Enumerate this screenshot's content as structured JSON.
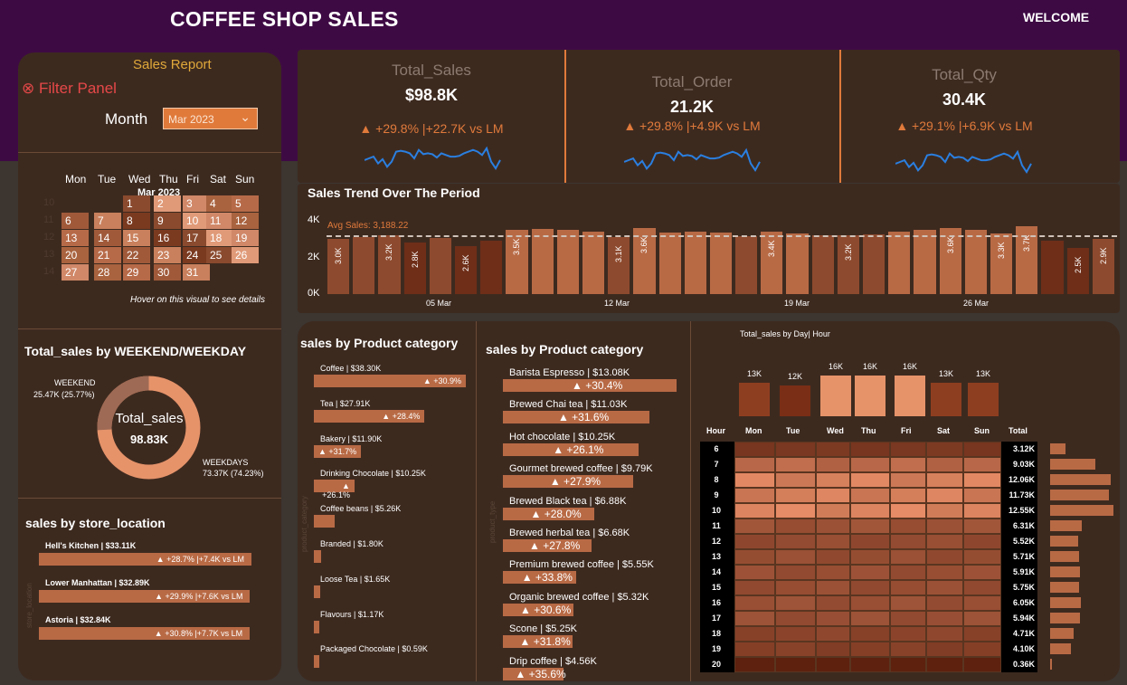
{
  "app": {
    "title": "COFFEE SHOP SALES",
    "welcome": "WELCOME"
  },
  "filter": {
    "report_label": "Sales Report",
    "panel_label": "Filter Panel",
    "month_label": "Month",
    "month_value": "Mar 2023",
    "calendar": {
      "month_title": "Mar 2023",
      "weekdays": [
        "Mon",
        "Tue",
        "Wed",
        "Thu",
        "Fri",
        "Sat",
        "Sun"
      ],
      "weeks": [
        "10",
        "11",
        "12",
        "13",
        "14"
      ],
      "days": [
        {
          "d": "1"
        },
        {
          "d": "2"
        },
        {
          "d": "3"
        },
        {
          "d": "4"
        },
        {
          "d": "5"
        },
        {
          "d": "6"
        },
        {
          "d": "7"
        },
        {
          "d": "8"
        },
        {
          "d": "9"
        },
        {
          "d": "10"
        },
        {
          "d": "11"
        },
        {
          "d": "12"
        },
        {
          "d": "13"
        },
        {
          "d": "14"
        },
        {
          "d": "15"
        },
        {
          "d": "16"
        },
        {
          "d": "17"
        },
        {
          "d": "18"
        },
        {
          "d": "19"
        },
        {
          "d": "20"
        },
        {
          "d": "21"
        },
        {
          "d": "22"
        },
        {
          "d": "23"
        },
        {
          "d": "24"
        },
        {
          "d": "25"
        },
        {
          "d": "26"
        },
        {
          "d": "27"
        },
        {
          "d": "28"
        },
        {
          "d": "29"
        },
        {
          "d": "30"
        },
        {
          "d": "31"
        }
      ],
      "hover_hint": "Hover on this visual to see details"
    }
  },
  "weekend": {
    "title": "Total_sales by WEEKEND/WEEKDAY",
    "center_label": "Total_sales",
    "center_value": "98.83K",
    "weekend_label": "WEEKEND",
    "weekend_value": "25.47K (25.77%)",
    "weekday_label": "WEEKDAYS",
    "weekday_value": "73.37K (74.23%)",
    "weekend_share": 0.2577
  },
  "store": {
    "title": "sales by store_location",
    "axis_label": "store_location",
    "items": [
      {
        "name": "Hell's Kitchen | $33.11K",
        "change": "▲ +28.7% |+7.4K vs LM",
        "value": 33.11
      },
      {
        "name": "Lower Manhattan | $32.89K",
        "change": "▲ +29.9% |+7.6K vs LM",
        "value": 32.89
      },
      {
        "name": "Astoria | $32.84K",
        "change": "▲ +30.8% |+7.7K vs LM",
        "value": 32.84
      }
    ]
  },
  "kpis": [
    {
      "label": "Total_Sales",
      "value": "$98.8K",
      "change": "▲ +29.8% |+22.7K vs LM"
    },
    {
      "label": "Total_Order",
      "value": "21.2K",
      "change": "▲ +29.8% |+4.9K vs LM"
    },
    {
      "label": "Total_Qty",
      "value": "30.4K",
      "change": "▲ +29.1% |+6.9K vs LM"
    }
  ],
  "trend_title": "Sales Trend Over The Period",
  "trend_avg_label": "Avg Sales: 3,188.22",
  "trend_y_ticks": [
    "4K",
    "2K",
    "0K"
  ],
  "trend_x_ticks": [
    "05 Mar",
    "12 Mar",
    "19 Mar",
    "26 Mar"
  ],
  "chart_data": {
    "type": "bar",
    "title": "Sales Trend Over The Period",
    "x": [
      "Mar 1",
      "Mar 2",
      "Mar 3",
      "Mar 4",
      "Mar 5",
      "Mar 6",
      "Mar 7",
      "Mar 8",
      "Mar 9",
      "Mar 10",
      "Mar 11",
      "Mar 12",
      "Mar 13",
      "Mar 14",
      "Mar 15",
      "Mar 16",
      "Mar 17",
      "Mar 18",
      "Mar 19",
      "Mar 20",
      "Mar 21",
      "Mar 22",
      "Mar 23",
      "Mar 24",
      "Mar 25",
      "Mar 26",
      "Mar 27",
      "Mar 28",
      "Mar 29",
      "Mar 30",
      "Mar 31"
    ],
    "values": [
      3000,
      3100,
      3200,
      2800,
      3050,
      2600,
      2900,
      3500,
      3550,
      3500,
      3400,
      3100,
      3600,
      3350,
      3400,
      3350,
      3150,
      3400,
      3300,
      3200,
      3200,
      3250,
      3400,
      3500,
      3600,
      3500,
      3300,
      3700,
      2900,
      2500,
      3000
    ],
    "data_labels": [
      "3.0K",
      "",
      "3.2K",
      "2.8K",
      "",
      "2.6K",
      "",
      "3.5K",
      "",
      "",
      "",
      "3.1K",
      "3.6K",
      "",
      "",
      "",
      "",
      "3.4K",
      "",
      "",
      "3.2K",
      "",
      "",
      "",
      "3.6K",
      "",
      "3.3K",
      "3.7K",
      "",
      "2.5K",
      "2.9K"
    ],
    "ylim": [
      0,
      4000
    ],
    "average": 3188.22
  },
  "categories": {
    "title": "sales by Product category",
    "axis_label": "product_category",
    "items": [
      {
        "name": "Coffee | $38.30K",
        "change": "▲ +30.9%",
        "value": 38.3
      },
      {
        "name": "Tea | $27.91K",
        "change": "▲ +28.4%",
        "value": 27.91
      },
      {
        "name": "Bakery | $11.90K",
        "change": "▲ +31.7%",
        "value": 11.9
      },
      {
        "name": "Drinking Chocolate | $10.25K",
        "change": "▲ +26.1%",
        "value": 10.25
      },
      {
        "name": "Coffee beans | $5.26K",
        "change": "",
        "value": 5.26
      },
      {
        "name": "Branded | $1.80K",
        "change": "",
        "value": 1.8
      },
      {
        "name": "Loose Tea | $1.65K",
        "change": "",
        "value": 1.65
      },
      {
        "name": "Flavours | $1.17K",
        "change": "",
        "value": 1.17
      },
      {
        "name": "Packaged Chocolate | $0.59K",
        "change": "",
        "value": 0.59
      }
    ]
  },
  "products": {
    "title": "sales by Product category",
    "axis_label": "product_type",
    "items": [
      {
        "name": "Barista Espresso | $13.08K",
        "change": "▲ +30.4%",
        "value": 13.08
      },
      {
        "name": "Brewed Chai tea | $11.03K",
        "change": "▲ +31.6%",
        "value": 11.03
      },
      {
        "name": "Hot chocolate | $10.25K",
        "change": "▲ +26.1%",
        "value": 10.25
      },
      {
        "name": "Gourmet brewed coffee | $9.79K",
        "change": "▲ +27.9%",
        "value": 9.79
      },
      {
        "name": "Brewed Black tea | $6.88K",
        "change": "▲ +28.0%",
        "value": 6.88
      },
      {
        "name": "Brewed herbal tea | $6.68K",
        "change": "▲ +27.8%",
        "value": 6.68
      },
      {
        "name": "Premium brewed coffee | $5.55K",
        "change": "▲ +33.8%",
        "value": 5.55
      },
      {
        "name": "Organic brewed coffee | $5.32K",
        "change": "▲ +30.6%",
        "value": 5.32
      },
      {
        "name": "Scone | $5.25K",
        "change": "▲ +31.8%",
        "value": 5.25
      },
      {
        "name": "Drip coffee | $4.56K",
        "change": "▲ +35.6%",
        "value": 4.56
      }
    ]
  },
  "heatmap": {
    "title": "Total_sales by Day| Hour",
    "hour_header": "Hour",
    "total_header": "Total",
    "days": [
      "Mon",
      "Tue",
      "Wed",
      "Thu",
      "Fri",
      "Sat",
      "Sun"
    ],
    "day_totals": [
      "13K",
      "12K",
      "16K",
      "16K",
      "16K",
      "13K",
      "13K"
    ],
    "day_values": [
      13,
      12,
      16,
      16,
      16,
      13,
      13
    ],
    "hours": [
      "6",
      "7",
      "8",
      "9",
      "10",
      "11",
      "12",
      "13",
      "14",
      "15",
      "16",
      "17",
      "18",
      "19",
      "20"
    ],
    "hour_totals": [
      "3.12K",
      "9.03K",
      "12.06K",
      "11.73K",
      "12.55K",
      "6.31K",
      "5.52K",
      "5.71K",
      "5.91K",
      "5.75K",
      "6.05K",
      "5.94K",
      "4.71K",
      "4.10K",
      "0.36K"
    ],
    "hour_values": [
      3.12,
      9.03,
      12.06,
      11.73,
      12.55,
      6.31,
      5.52,
      5.71,
      5.91,
      5.75,
      6.05,
      5.94,
      4.71,
      4.1,
      0.36
    ]
  },
  "colors": {
    "accent": "#e07a3b",
    "bar": "#b86a45",
    "header_bg": "#3e0a44",
    "panel_bg": "#3d2a1f",
    "sparkline": "#2a7fe0"
  }
}
